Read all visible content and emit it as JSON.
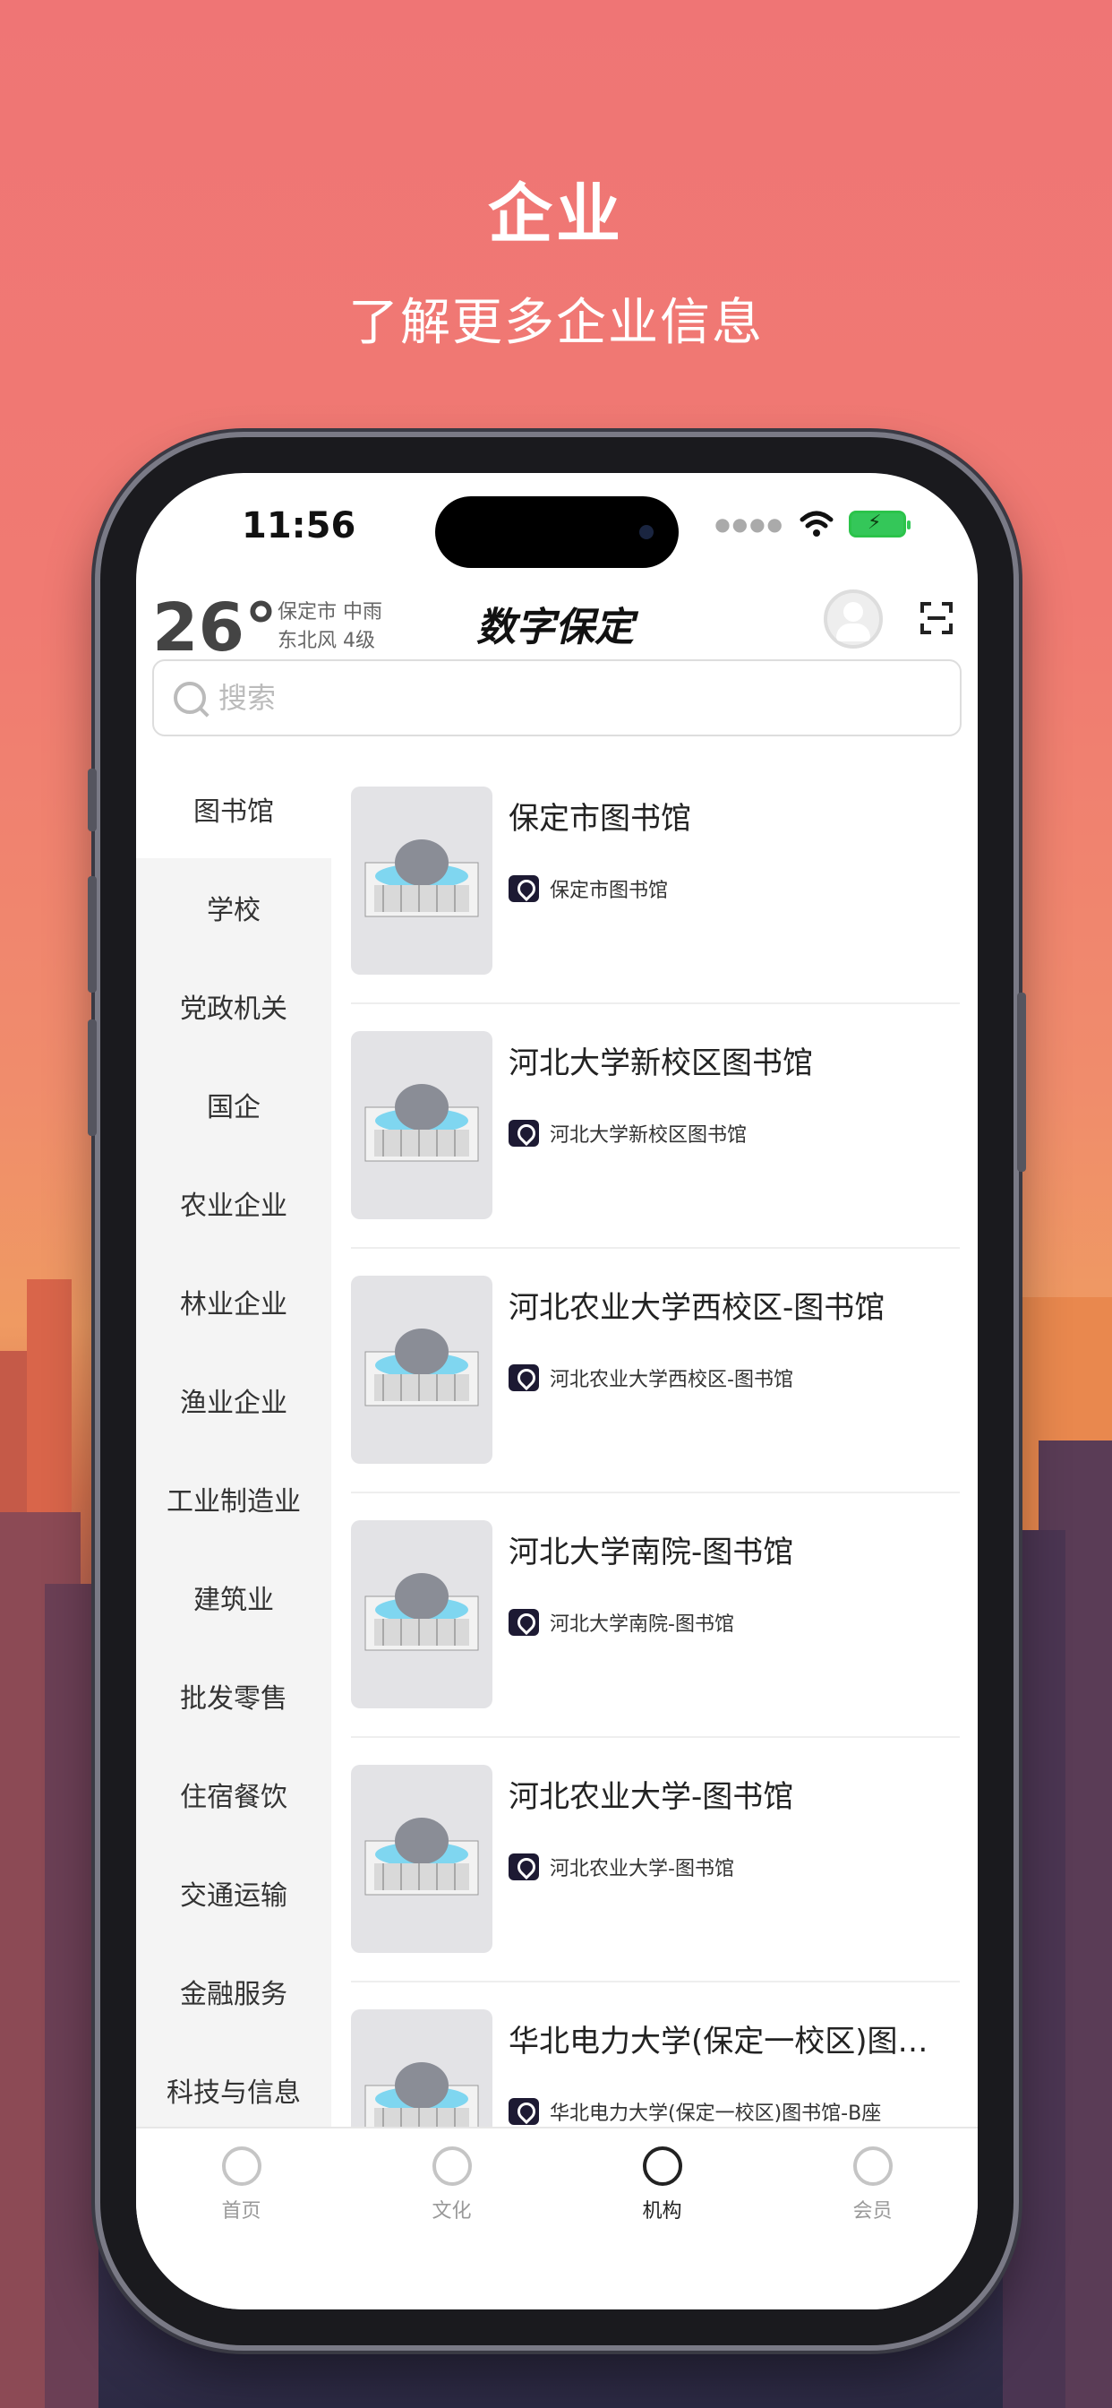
{
  "promo": {
    "title": "企业",
    "subtitle": "了解更多企业信息"
  },
  "status_bar": {
    "time": "11:56"
  },
  "header": {
    "temperature": "26°",
    "weather_line1": "保定市 中雨",
    "weather_line2": "东北风 4级",
    "app_title": "数字保定"
  },
  "search": {
    "placeholder": "搜索"
  },
  "categories": [
    {
      "label": "图书馆",
      "active": true
    },
    {
      "label": "学校"
    },
    {
      "label": "党政机关"
    },
    {
      "label": "国企"
    },
    {
      "label": "农业企业"
    },
    {
      "label": "林业企业"
    },
    {
      "label": "渔业企业"
    },
    {
      "label": "工业制造业"
    },
    {
      "label": "建筑业"
    },
    {
      "label": "批发零售"
    },
    {
      "label": "住宿餐饮"
    },
    {
      "label": "交通运输"
    },
    {
      "label": "金融服务"
    },
    {
      "label": "科技与信息"
    }
  ],
  "items": [
    {
      "title": "保定市图书馆",
      "tag": "保定市图书馆"
    },
    {
      "title": "河北大学新校区图书馆",
      "tag": "河北大学新校区图书馆"
    },
    {
      "title": "河北农业大学西校区-图书馆",
      "tag": "河北农业大学西校区-图书馆"
    },
    {
      "title": "河北大学南院-图书馆",
      "tag": "河北大学南院-图书馆"
    },
    {
      "title": "河北农业大学-图书馆",
      "tag": "河北农业大学-图书馆"
    },
    {
      "title": "华北电力大学(保定一校区)图书馆",
      "tag": "华北电力大学(保定一校区)图书馆-B座"
    }
  ],
  "tabbar": [
    {
      "label": "首页",
      "icon": "home-icon"
    },
    {
      "label": "文化",
      "icon": "culture-icon"
    },
    {
      "label": "机构",
      "icon": "phone-icon",
      "active": true
    },
    {
      "label": "会员",
      "icon": "star-icon"
    }
  ],
  "colors": {
    "background_top": "#ef7575",
    "background_bottom": "#2c2a44",
    "pin_badge": "#1d1a33"
  }
}
